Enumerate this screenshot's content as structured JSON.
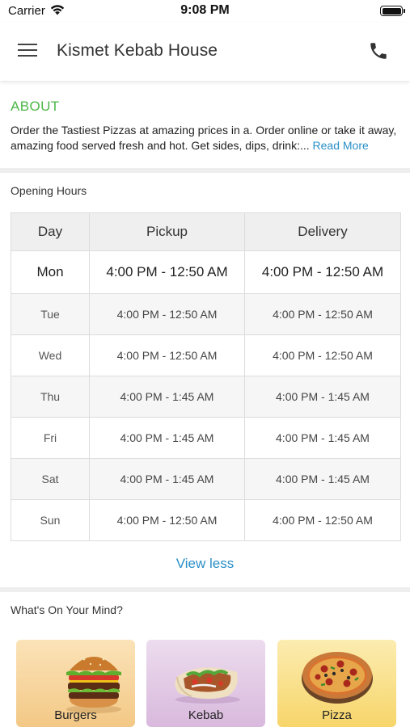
{
  "status_bar": {
    "carrier": "Carrier",
    "time": "9:08 PM"
  },
  "header": {
    "title": "Kismet Kebab House"
  },
  "about": {
    "title": "ABOUT",
    "text": "Order the Tastiest Pizzas at amazing prices in a. Order online or take it away, amazing food served fresh and hot. Get sides, dips, drink:...",
    "read_more": "Read More"
  },
  "hours": {
    "label": "Opening Hours",
    "columns": [
      "Day",
      "Pickup",
      "Delivery"
    ],
    "rows": [
      {
        "day": "Mon",
        "pickup": "4:00 PM - 12:50 AM",
        "delivery": "4:00 PM - 12:50 AM"
      },
      {
        "day": "Tue",
        "pickup": "4:00 PM - 12:50 AM",
        "delivery": "4:00 PM - 12:50 AM"
      },
      {
        "day": "Wed",
        "pickup": "4:00 PM - 12:50 AM",
        "delivery": "4:00 PM - 12:50 AM"
      },
      {
        "day": "Thu",
        "pickup": "4:00 PM - 1:45 AM",
        "delivery": "4:00 PM - 1:45 AM"
      },
      {
        "day": "Fri",
        "pickup": "4:00 PM - 1:45 AM",
        "delivery": "4:00 PM - 1:45 AM"
      },
      {
        "day": "Sat",
        "pickup": "4:00 PM - 1:45 AM",
        "delivery": "4:00 PM - 1:45 AM"
      },
      {
        "day": "Sun",
        "pickup": "4:00 PM - 12:50 AM",
        "delivery": "4:00 PM - 12:50 AM"
      }
    ],
    "view_less": "View less"
  },
  "mind": {
    "label": "What's On Your Mind?",
    "categories": [
      {
        "label": "Burgers",
        "icon": "burger-icon"
      },
      {
        "label": "Kebab",
        "icon": "kebab-icon"
      },
      {
        "label": "Pizza",
        "icon": "pizza-icon"
      }
    ]
  },
  "colors": {
    "accent_green": "#4cb748",
    "link_blue": "#2a8fc7"
  }
}
